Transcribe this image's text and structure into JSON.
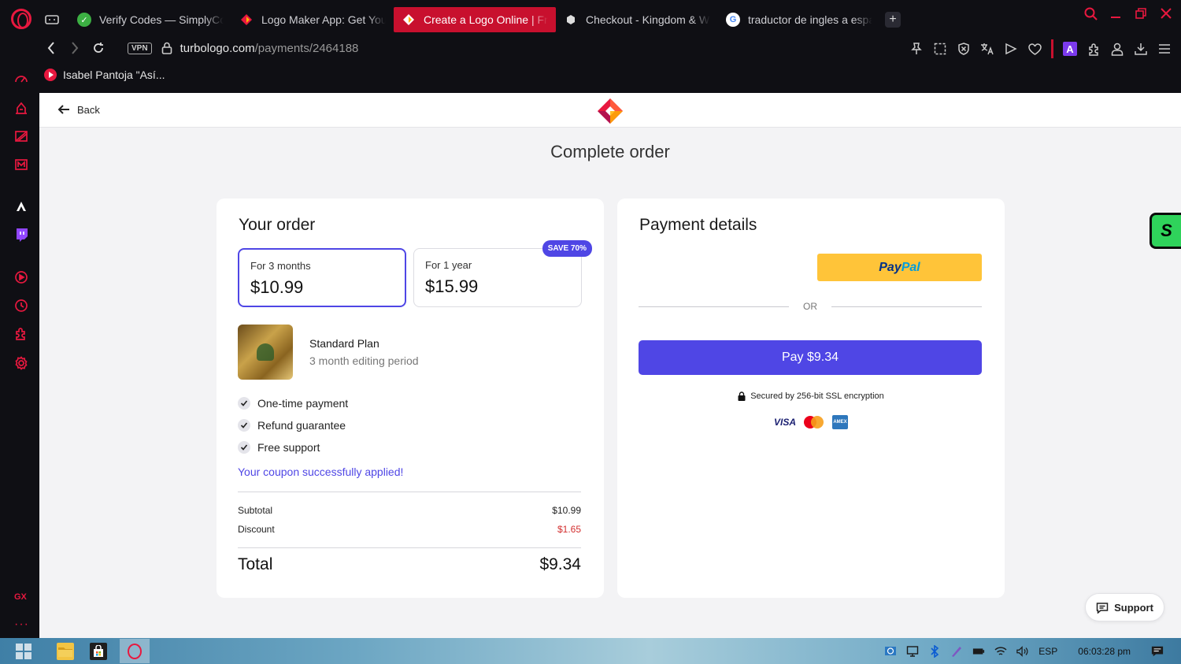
{
  "browser": {
    "tabs": [
      {
        "title": "Verify Codes — SimplyCodes",
        "favicon_color": "#3cb043",
        "active": false
      },
      {
        "title": "Logo Maker App: Get Your",
        "favicon_color": "#e8183f",
        "active": false
      },
      {
        "title": "Create a Logo Online | Free",
        "favicon_color": "#e8183f",
        "active": true
      },
      {
        "title": "Checkout - Kingdom & Wolves",
        "favicon_color": "#dddddd",
        "active": false
      },
      {
        "title": "traductor de ingles a espanol",
        "favicon_color": "#ffffff",
        "active": false
      }
    ],
    "new_tab": "+",
    "vpn_label": "VPN",
    "url_domain": "turbologo.com",
    "url_path": "/payments/2464188",
    "bookmark": "Isabel Pantoja \"Así...",
    "accent": "#c8102e",
    "sidebar_gx": "GX",
    "sidebar_more": "···"
  },
  "page": {
    "back_label": "Back",
    "title": "Complete order",
    "order": {
      "heading": "Your order",
      "plans": [
        {
          "label": "For 3 months",
          "price": "$10.99",
          "selected": true
        },
        {
          "label": "For 1 year",
          "price": "$15.99",
          "badge": "SAVE 70%",
          "selected": false
        }
      ],
      "product_name": "Standard Plan",
      "product_sub": "3 month editing period",
      "features": [
        "One-time payment",
        "Refund guarantee",
        "Free support"
      ],
      "coupon_message": "Your coupon successfully applied!",
      "subtotal_label": "Subtotal",
      "subtotal_value": "$10.99",
      "discount_label": "Discount",
      "discount_value": "$1.65",
      "total_label": "Total",
      "total_value": "$9.34"
    },
    "payment": {
      "heading": "Payment details",
      "paypal_part1": "Pay",
      "paypal_part2": "Pal",
      "or_label": "OR",
      "pay_button": "Pay $9.34",
      "secured_text": "Secured by 256-bit SSL encryption",
      "card_visa": "VISA",
      "card_amex": "AMEX"
    },
    "support_label": "Support",
    "widget_letter": "S",
    "accent_color": "#4f46e5"
  },
  "taskbar": {
    "language": "ESP",
    "clock": "06:03:28 pm"
  }
}
